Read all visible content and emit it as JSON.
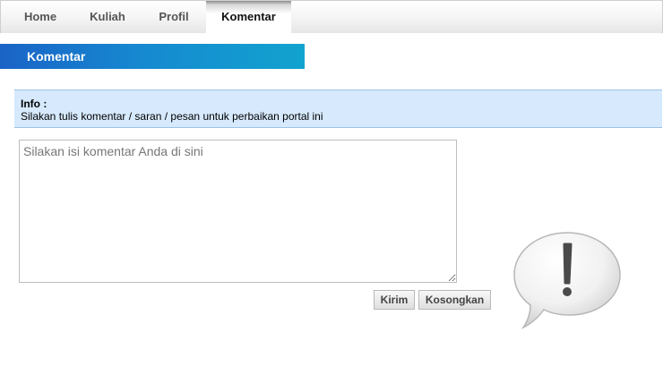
{
  "nav": {
    "items": [
      {
        "label": "Home",
        "active": false
      },
      {
        "label": "Kuliah",
        "active": false
      },
      {
        "label": "Profil",
        "active": false
      },
      {
        "label": "Komentar",
        "active": true
      }
    ]
  },
  "section": {
    "title": "Komentar"
  },
  "info": {
    "label": "Info :",
    "text": "Silakan tulis komentar / saran / pesan untuk perbaikan portal ini"
  },
  "comment": {
    "placeholder": "Silakan isi komentar Anda di sini",
    "value": ""
  },
  "buttons": {
    "submit_label": "Kirim",
    "clear_label": "Kosongkan"
  },
  "icons": {
    "alert": "exclamation-speech-bubble-icon"
  },
  "colors": {
    "header_gradient_start": "#1a63c6",
    "header_gradient_end": "#12a3cf",
    "info_background": "#d6e9fd"
  }
}
